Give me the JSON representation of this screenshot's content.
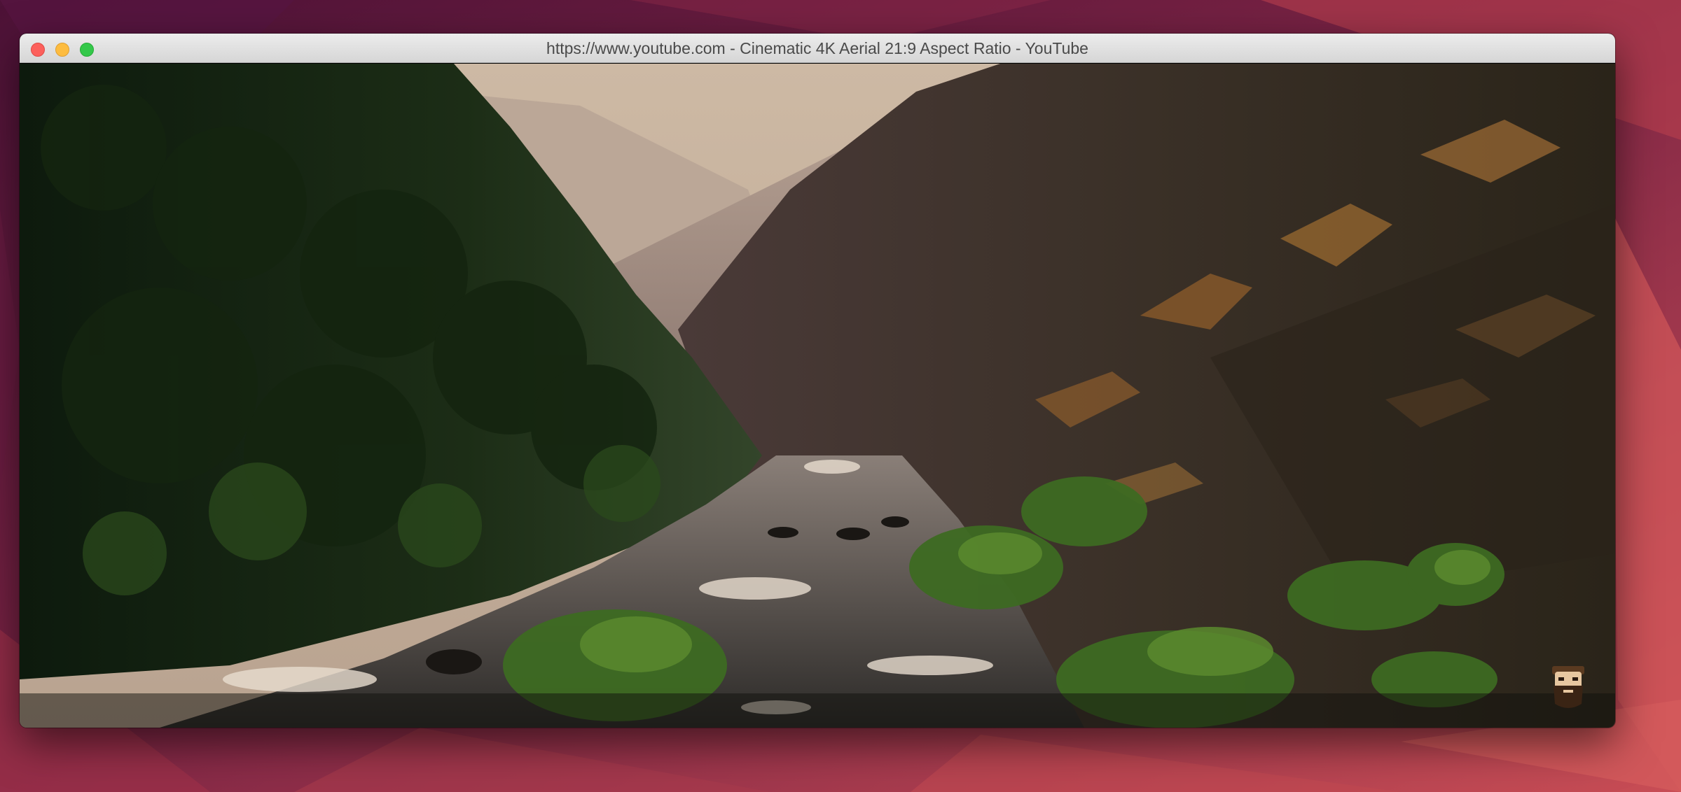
{
  "window": {
    "title": "https://www.youtube.com - Cinematic 4K Aerial 21:9 Aspect Ratio - YouTube",
    "controls": {
      "close": "close-button",
      "minimize": "minimize-button",
      "zoom": "zoom-button"
    }
  },
  "video": {
    "scene": "aerial river canyon",
    "channel_watermark_icon": "bearded-face-icon"
  },
  "colors": {
    "desktop_top": "#5b1a3d",
    "desktop_bottom": "#c34a52",
    "traffic_close": "#fc605c",
    "traffic_minimize": "#fdbc40",
    "traffic_zoom": "#34c84a",
    "titlebar": "#e3e3e3"
  }
}
